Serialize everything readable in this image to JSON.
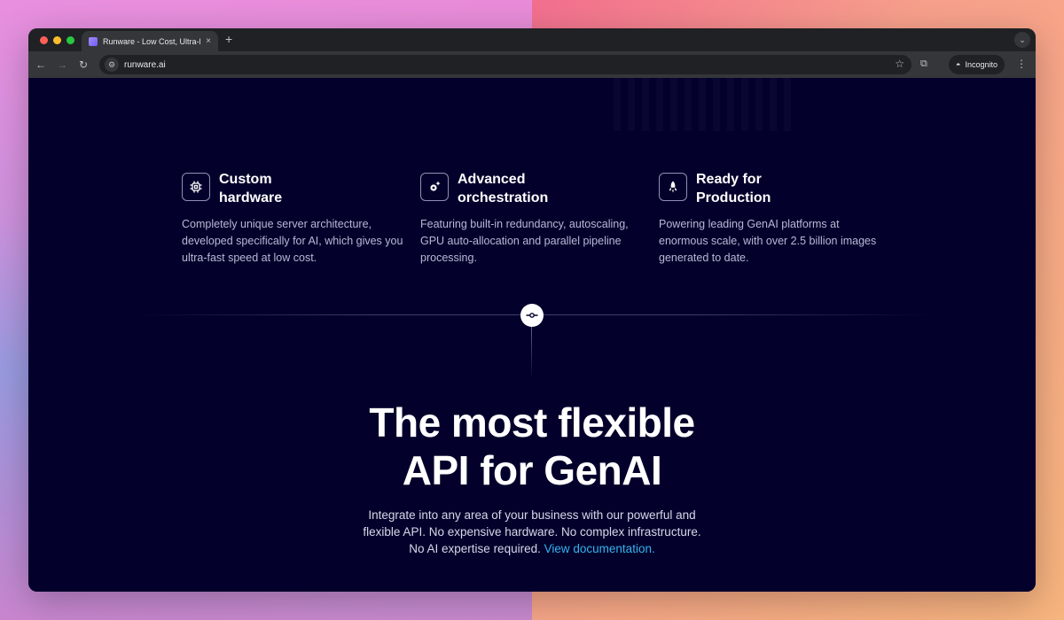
{
  "browser": {
    "tab_title": "Runware - Low Cost, Ultra-Fa",
    "tab_close": "×",
    "new_tab": "+",
    "url": "runware.ai",
    "incognito_label": "Incognito"
  },
  "features": [
    {
      "icon": "chip-icon",
      "title": "Custom hardware",
      "description": "Completely unique server architecture, developed specifically for AI, which gives you ultra-fast speed at low cost."
    },
    {
      "icon": "gear-sparkle-icon",
      "title": "Advanced orchestration",
      "description": "Featuring built-in redundancy, autoscaling, GPU auto-allocation and parallel pipeline processing."
    },
    {
      "icon": "rocket-icon",
      "title": "Ready for Production",
      "description": "Powering leading GenAI platforms at enormous scale, with over 2.5 billion images generated to date."
    }
  ],
  "headline": {
    "line1": "The most flexible",
    "line2": "API for GenAI"
  },
  "subtext": {
    "line1": "Integrate into any area of your business with our powerful and",
    "line2": "flexible API. No expensive hardware. No complex infrastructure.",
    "line3": "No AI expertise required.",
    "link": "View documentation."
  },
  "colors": {
    "page_background": "#03012b",
    "link": "#35b3f0"
  }
}
